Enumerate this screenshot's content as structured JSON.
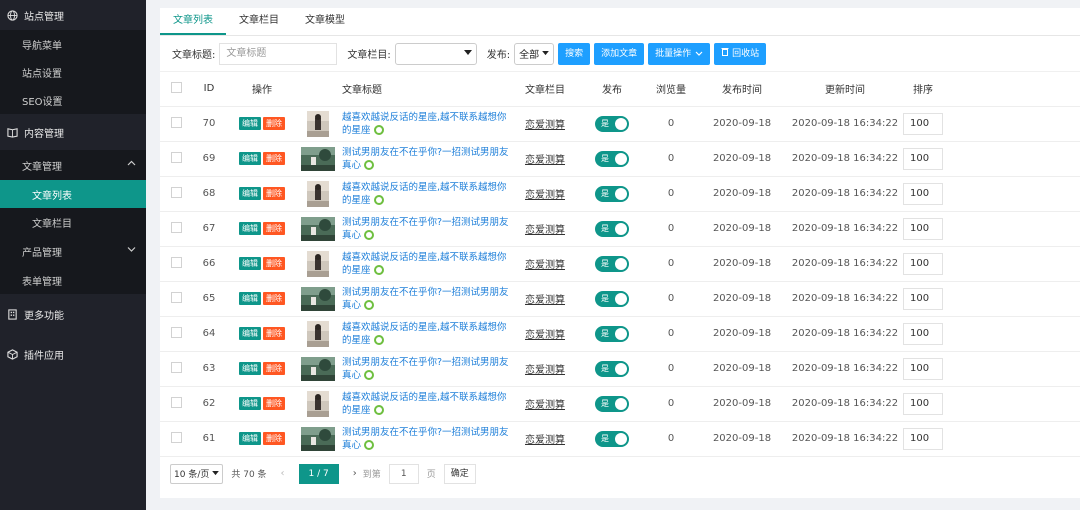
{
  "sidebar": {
    "groups": [
      {
        "label": "站点管理",
        "icon": "globe-icon",
        "items": [
          "导航菜单",
          "站点设置",
          "SEO设置"
        ]
      },
      {
        "label": "内容管理",
        "icon": "book-icon"
      },
      {
        "label": "更多功能",
        "icon": "building-icon"
      },
      {
        "label": "插件应用",
        "icon": "cube-icon"
      }
    ],
    "content_items": {
      "article_mgmt": "文章管理",
      "article_list": "文章列表",
      "article_column": "文章栏目",
      "product_mgmt": "产品管理",
      "form_mgmt": "表单管理"
    }
  },
  "tabs": [
    "文章列表",
    "文章栏目",
    "文章模型"
  ],
  "toolbar": {
    "title_label": "文章标题:",
    "title_placeholder": "文章标题",
    "column_label": "文章栏目:",
    "publish_label": "发布:",
    "publish_value": "全部",
    "search_btn": "搜索",
    "add_btn": "添加文章",
    "batch_btn": "批量操作",
    "recycle_btn": "回收站"
  },
  "table": {
    "headers": [
      "ID",
      "操作",
      "文章标题",
      "文章栏目",
      "发布",
      "浏览量",
      "发布时间",
      "更新时间",
      "排序"
    ],
    "edit_label": "编辑",
    "delete_label": "删除",
    "switch_label": "是",
    "rows": [
      {
        "id": "70",
        "title": "越喜欢越说反话的星座,越不联系越想你的星座",
        "column": "恋爱测算",
        "views": "0",
        "pub": "2020-09-18",
        "upd": "2020-09-18 16:34:22",
        "sort": "100",
        "thumb": "a"
      },
      {
        "id": "69",
        "title": "测试男朋友在不在乎你?一招测试男朋友真心",
        "column": "恋爱测算",
        "views": "0",
        "pub": "2020-09-18",
        "upd": "2020-09-18 16:34:22",
        "sort": "100",
        "thumb": "b"
      },
      {
        "id": "68",
        "title": "越喜欢越说反话的星座,越不联系越想你的星座",
        "column": "恋爱测算",
        "views": "0",
        "pub": "2020-09-18",
        "upd": "2020-09-18 16:34:22",
        "sort": "100",
        "thumb": "a"
      },
      {
        "id": "67",
        "title": "测试男朋友在不在乎你?一招测试男朋友真心",
        "column": "恋爱测算",
        "views": "0",
        "pub": "2020-09-18",
        "upd": "2020-09-18 16:34:22",
        "sort": "100",
        "thumb": "b"
      },
      {
        "id": "66",
        "title": "越喜欢越说反话的星座,越不联系越想你的星座",
        "column": "恋爱测算",
        "views": "0",
        "pub": "2020-09-18",
        "upd": "2020-09-18 16:34:22",
        "sort": "100",
        "thumb": "a"
      },
      {
        "id": "65",
        "title": "测试男朋友在不在乎你?一招测试男朋友真心",
        "column": "恋爱测算",
        "views": "0",
        "pub": "2020-09-18",
        "upd": "2020-09-18 16:34:22",
        "sort": "100",
        "thumb": "b"
      },
      {
        "id": "64",
        "title": "越喜欢越说反话的星座,越不联系越想你的星座",
        "column": "恋爱测算",
        "views": "0",
        "pub": "2020-09-18",
        "upd": "2020-09-18 16:34:22",
        "sort": "100",
        "thumb": "a"
      },
      {
        "id": "63",
        "title": "测试男朋友在不在乎你?一招测试男朋友真心",
        "column": "恋爱测算",
        "views": "0",
        "pub": "2020-09-18",
        "upd": "2020-09-18 16:34:22",
        "sort": "100",
        "thumb": "b"
      },
      {
        "id": "62",
        "title": "越喜欢越说反话的星座,越不联系越想你的星座",
        "column": "恋爱测算",
        "views": "0",
        "pub": "2020-09-18",
        "upd": "2020-09-18 16:34:22",
        "sort": "100",
        "thumb": "a"
      },
      {
        "id": "61",
        "title": "测试男朋友在不在乎你?一招测试男朋友真心",
        "column": "恋爱测算",
        "views": "0",
        "pub": "2020-09-18",
        "upd": "2020-09-18 16:34:22",
        "sort": "100",
        "thumb": "b"
      }
    ]
  },
  "pager": {
    "per_page": "10 条/页",
    "total": "共 70 条",
    "current": "1 / 7",
    "goto_label": "到第",
    "goto_value": "1",
    "page_unit": "页",
    "ok_btn": "确定"
  },
  "colors": {
    "accent": "#0e968a",
    "blue": "#1e9fff",
    "danger": "#ff5722",
    "sidebar": "#20222a"
  }
}
